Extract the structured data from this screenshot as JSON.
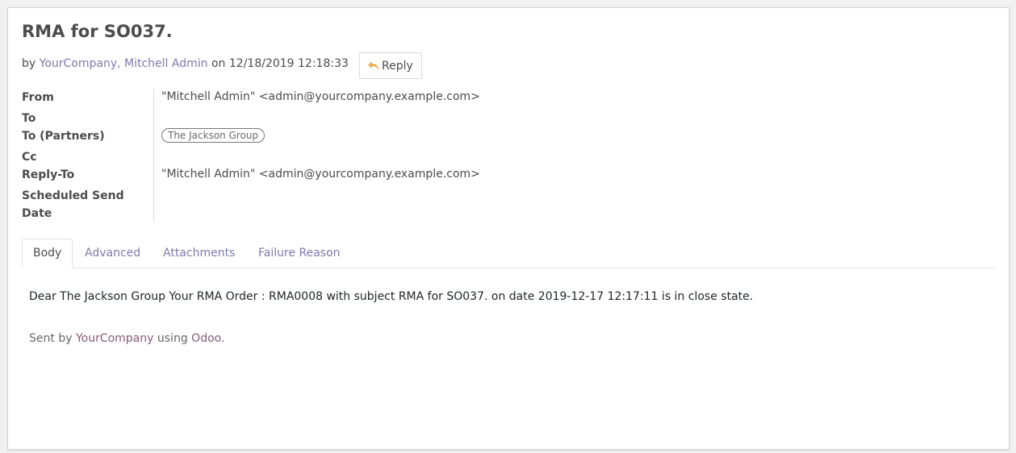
{
  "message": {
    "title": "RMA for SO037.",
    "by_prefix": "by",
    "authors": "YourCompany, Mitchell Admin",
    "on_prefix": "on",
    "date": "12/18/2019 12:18:33",
    "reply_label": "Reply"
  },
  "fields": {
    "from_label": "From",
    "from_value": "\"Mitchell Admin\" <admin@yourcompany.example.com>",
    "to_label": "To",
    "to_partners_label": "To (Partners)",
    "to_partners_tag": "The Jackson Group",
    "cc_label": "Cc",
    "reply_to_label": "Reply-To",
    "reply_to_value": "\"Mitchell Admin\" <admin@yourcompany.example.com>",
    "scheduled_label_line1": "Scheduled Send",
    "scheduled_label_line2": "Date"
  },
  "tabs": [
    {
      "label": "Body",
      "active": true
    },
    {
      "label": "Advanced",
      "active": false
    },
    {
      "label": "Attachments",
      "active": false
    },
    {
      "label": "Failure Reason",
      "active": false
    }
  ],
  "body": {
    "text": "Dear The Jackson Group Your RMA Order : RMA0008 with subject RMA for SO037. on date 2019-12-17 12:17:11 is in close state.",
    "sent_by_prefix": "Sent by",
    "company": "YourCompany",
    "using": "using",
    "platform": "Odoo",
    "period": "."
  },
  "colors": {
    "link": "#7c7bad",
    "footer_link": "#875a7b",
    "reply_icon": "#f0ad4e",
    "text": "#4c4c4c"
  },
  "icons": {
    "reply": "reply-arrow-icon"
  }
}
